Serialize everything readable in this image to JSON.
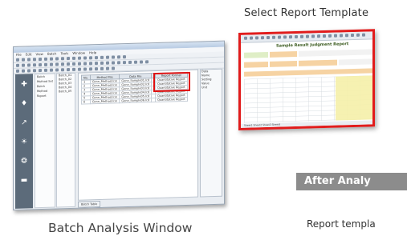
{
  "captions": {
    "select_report_template": "Select  Report Template",
    "batch_analysis_window": "Batch Analysis Window",
    "after_analysis": "After Analy",
    "report_template": "Report templa"
  },
  "batch_window": {
    "menu": [
      "File",
      "Edit",
      "View",
      "Batch",
      "Tools",
      "Window",
      "Help"
    ],
    "nav": [
      {
        "icon": "pin-icon",
        "glyph": "✚"
      },
      {
        "icon": "scope-icon",
        "glyph": "♦"
      },
      {
        "icon": "chart-icon",
        "glyph": "↗"
      },
      {
        "icon": "sun-icon",
        "glyph": "☀"
      },
      {
        "icon": "cog-icon",
        "glyph": "❂"
      },
      {
        "icon": "monitor-icon",
        "glyph": "▬"
      }
    ],
    "tree_items": [
      "Batch",
      "Method Set",
      "Batch",
      "Method",
      "Report"
    ],
    "file_items": [
      "Batch_01",
      "Batch_02",
      "Batch_03",
      "Batch_04",
      "Batch_05"
    ],
    "table_columns": [
      "No.",
      "Method File",
      "Data File",
      "",
      "Report Format"
    ],
    "table_rows": [
      [
        "1",
        "Gene_Method.lcm",
        "Gene_Sample01.lcd",
        "",
        "Quantitative Report"
      ],
      [
        "2",
        "Gene_Method.lcm",
        "Gene_Sample02.lcd",
        "",
        "Quantitative Report"
      ],
      [
        "3",
        "Gene_Method.lcm",
        "Gene_Sample03.lcd",
        "",
        "Quantitative Report"
      ],
      [
        "4",
        "Gene_Method.lcm",
        "Gene_Sample04.lcd",
        "",
        "Quantitative Report"
      ],
      [
        "5",
        "Gene_Method.lcm",
        "Gene_Sample05.lcd",
        "",
        "Quantitative Report"
      ],
      [
        "6",
        "Gene_Method.lcm",
        "Gene_Sample06.lcd",
        "",
        "Quantitative Report"
      ]
    ],
    "right_items": [
      "Data",
      "Name",
      "Setting",
      "Value",
      "Unit"
    ],
    "tab": "Batch Table"
  },
  "report_window": {
    "title": "Sample Result Judgment Report",
    "sheets": "Sheet1  Sheet2  Sheet3  Sheet4"
  },
  "colors": {
    "highlight": "#e01010",
    "banner": "#8c8c8c",
    "report_yellow": "#f5f0a8",
    "report_orange": "#f6d3a3",
    "report_green": "#dfeec6"
  }
}
